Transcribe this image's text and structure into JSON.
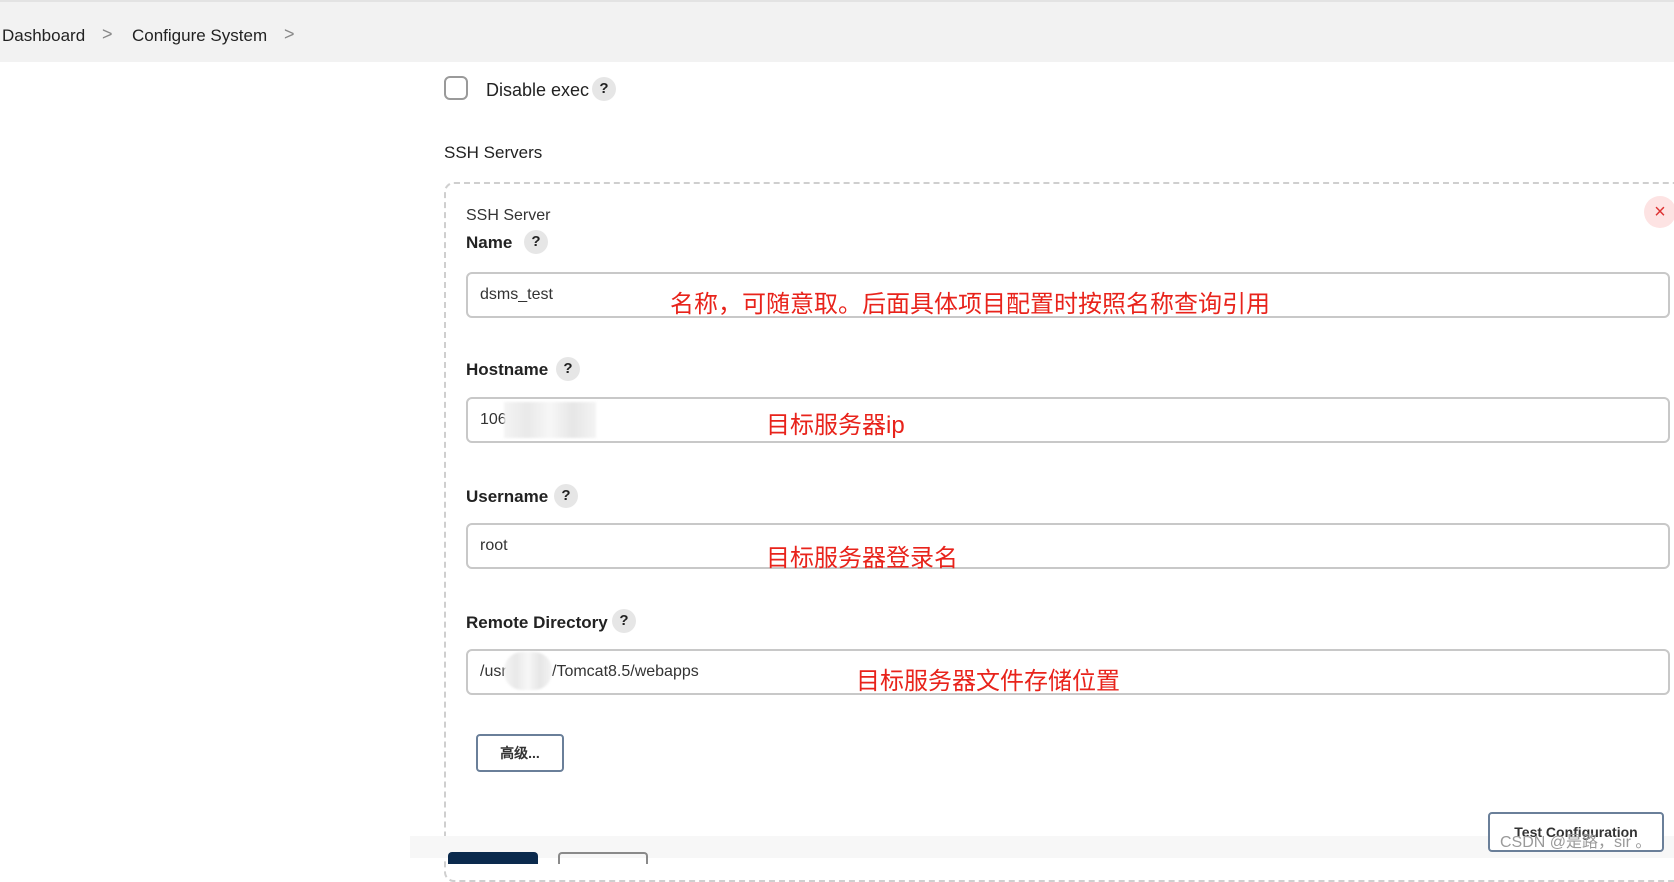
{
  "breadcrumb": {
    "items": [
      "Dashboard",
      "Configure System"
    ],
    "separator": ">"
  },
  "disable_exec": {
    "label": "Disable exec",
    "checked": false
  },
  "help_glyph": "?",
  "ssh_servers": {
    "title": "SSH Servers",
    "server": {
      "caption": "SSH Server",
      "close_glyph": "×",
      "fields": {
        "name": {
          "label": "Name",
          "value": "dsms_test",
          "annotation": "名称，可随意取。后面具体项目配置时按照名称查询引用"
        },
        "hostname": {
          "label": "Hostname",
          "value": "106",
          "annotation": "目标服务器ip"
        },
        "username": {
          "label": "Username",
          "value": "root",
          "annotation": "目标服务器登录名"
        },
        "remote_directory": {
          "label": "Remote Directory",
          "value_prefix": "/usr",
          "value_suffix": "/Tomcat8.5/webapps",
          "annotation": "目标服务器文件存储位置"
        }
      },
      "advanced_button": "高级...",
      "test_button": "Test Configuration"
    }
  },
  "watermark": "CSDN @是路，sir 。",
  "colors": {
    "annotation": "#e8231b",
    "close": "#d33333",
    "primary_button": "#0b2a4d"
  }
}
